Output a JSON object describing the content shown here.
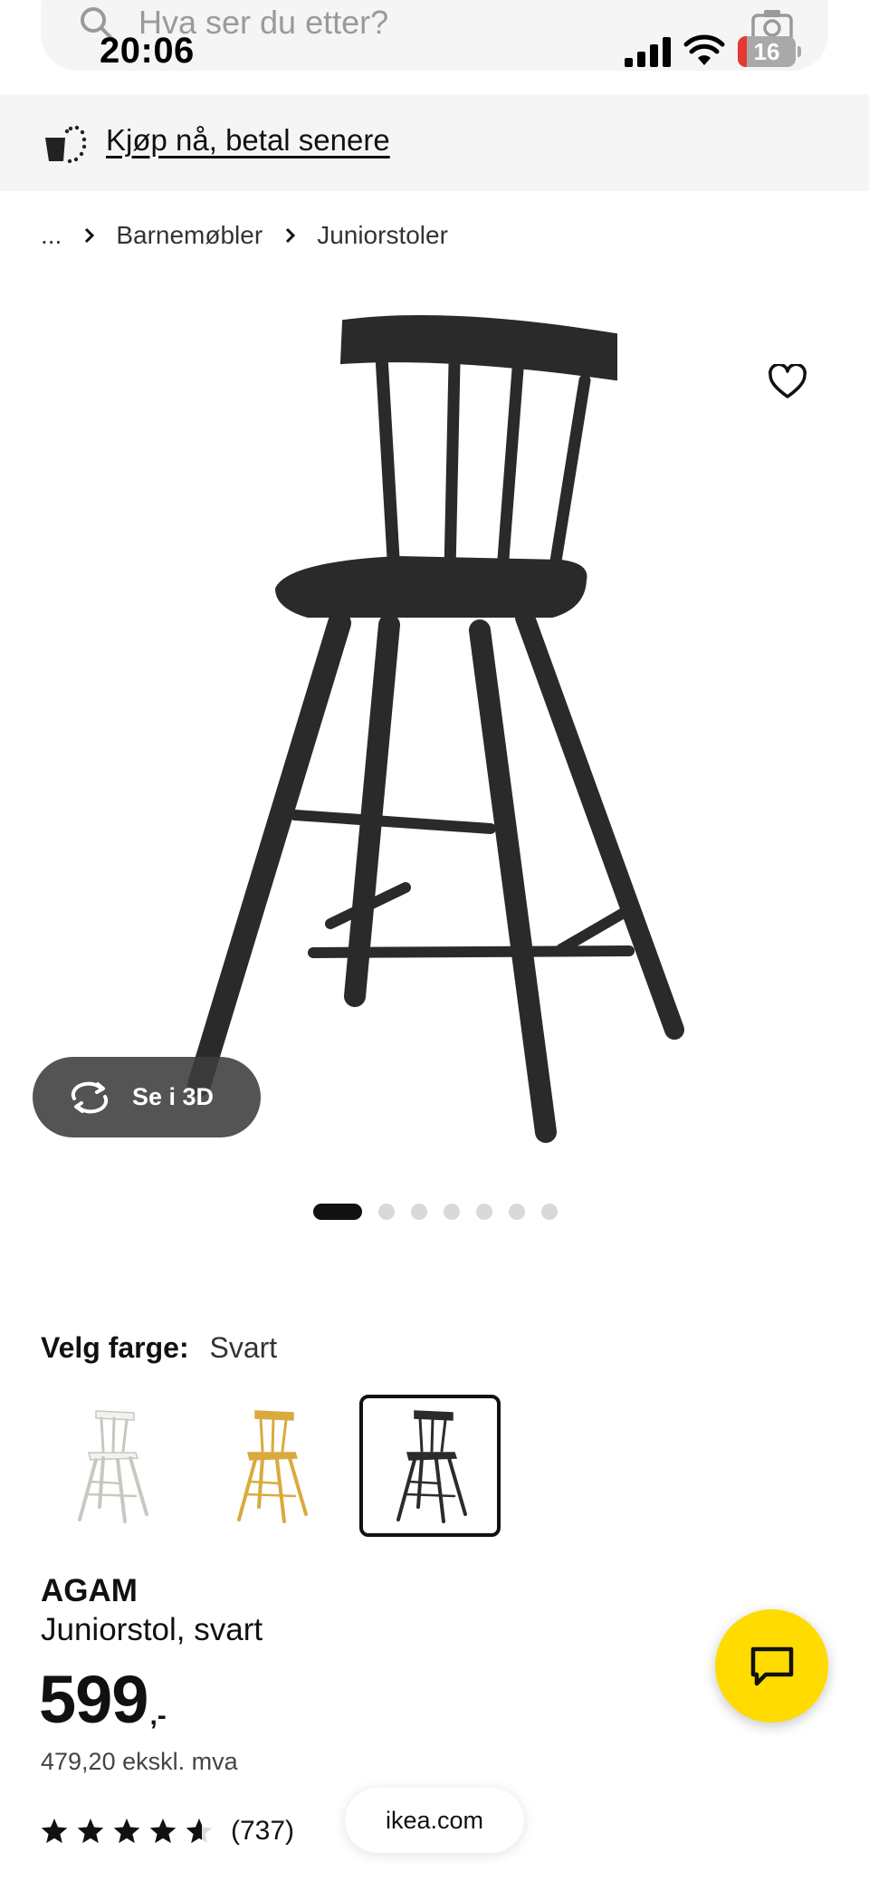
{
  "search": {
    "placeholder": "Hva ser du etter?"
  },
  "status_bar": {
    "time": "20:06",
    "battery_level": "16",
    "battery_percent": 16
  },
  "banner": {
    "link_text": "Kjøp nå, betal senere",
    "icon": "shopping-bag-icon"
  },
  "breadcrumb": {
    "items": [
      "...",
      "Barnemøbler",
      "Juniorstoler"
    ]
  },
  "gallery": {
    "view_3d_label": "Se i 3D",
    "image_count": 7,
    "active_index": 0
  },
  "color_selection": {
    "label": "Velg farge:",
    "selected": "Svart",
    "swatches": [
      {
        "color": "#f2f2ee",
        "selected": false
      },
      {
        "color": "#d9aa3e",
        "selected": false
      },
      {
        "color": "#2b2b2b",
        "selected": true
      }
    ]
  },
  "product": {
    "name": "AGAM",
    "description": "Juniorstol, svart",
    "price": "599",
    "price_suffix": ",-",
    "price_ex_vat": "479,20 ekskl. mva",
    "rating_value": 4.6,
    "rating_count": "(737)"
  },
  "footer": {
    "site": "ikea.com"
  },
  "colors": {
    "accent_yellow": "#ffdb00",
    "chair_black": "#2a2a2a",
    "banner_bg": "#f5f5f5"
  }
}
